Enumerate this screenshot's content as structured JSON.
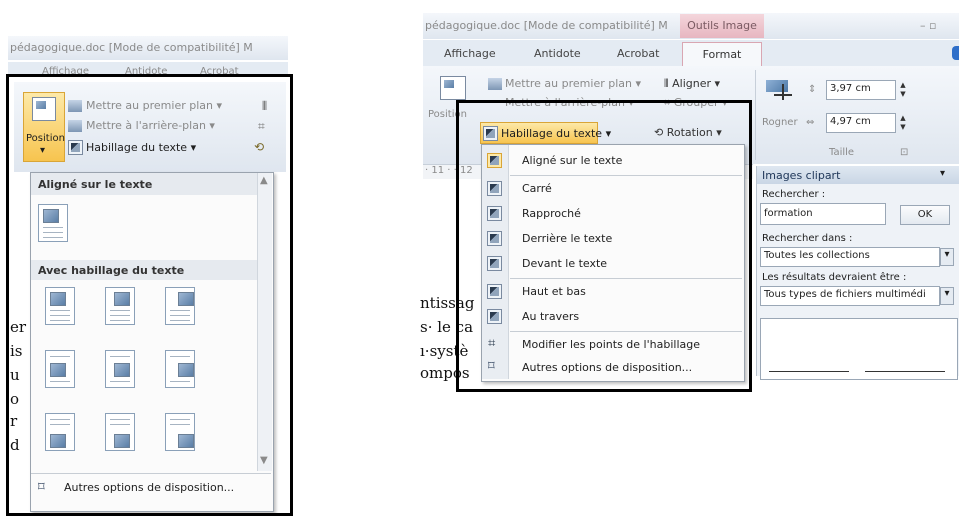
{
  "left": {
    "title": "pédagogique.doc [Mode de compatibilité] M",
    "tabs": [
      "Affichage",
      "Antidote",
      "Acrobat"
    ],
    "ribbon": {
      "position_label": "Position",
      "bring_front": "Mettre au premier plan",
      "send_back": "Mettre à l'arrière-plan",
      "wrap_text": "Habillage du texte"
    },
    "dropdown": {
      "inline_heading": "Aligné sur le texte",
      "wrap_heading": "Avec habillage du texte",
      "more_options": "Autres options de disposition..."
    },
    "doc_fragments": [
      "er",
      "is",
      "u",
      "o",
      "r",
      "d"
    ]
  },
  "right": {
    "title": "pédagogique.doc [Mode de compatibilité] M",
    "context_tab": "Outils Image",
    "window_controls": "– ▫",
    "tabs": [
      "Affichage",
      "Antidote",
      "Acrobat",
      "Format"
    ],
    "ribbon": {
      "position_label": "Position",
      "bring_front": "Mettre au premier plan",
      "send_back": "Mettre à l'arrière-plan",
      "align": "Aligner",
      "group": "Grouper",
      "wrap_text": "Habillage du texte",
      "rotation": "Rotation",
      "crop": "Rogner",
      "height": "3,97 cm",
      "width": "4,97 cm",
      "size_group": "Taille"
    },
    "ruler": "· 11 · · 12",
    "menu_items": [
      "Aligné sur le texte",
      "Carré",
      "Rapproché",
      "Derrière le texte",
      "Devant le texte",
      "Haut et bas",
      "Au travers",
      "Modifier les points de l'habillage",
      "Autres options de disposition..."
    ],
    "doc_fragments": [
      "ntissag",
      "s· le ca",
      "ı·systè",
      "ompos"
    ],
    "clipart": {
      "title": "Images clipart",
      "search_label": "Rechercher :",
      "search_value": "formation",
      "ok": "OK",
      "search_in_label": "Rechercher dans :",
      "search_in_value": "Toutes les collections",
      "results_label": "Les résultats devraient être :",
      "results_value": "Tous types de fichiers multimédi"
    }
  }
}
